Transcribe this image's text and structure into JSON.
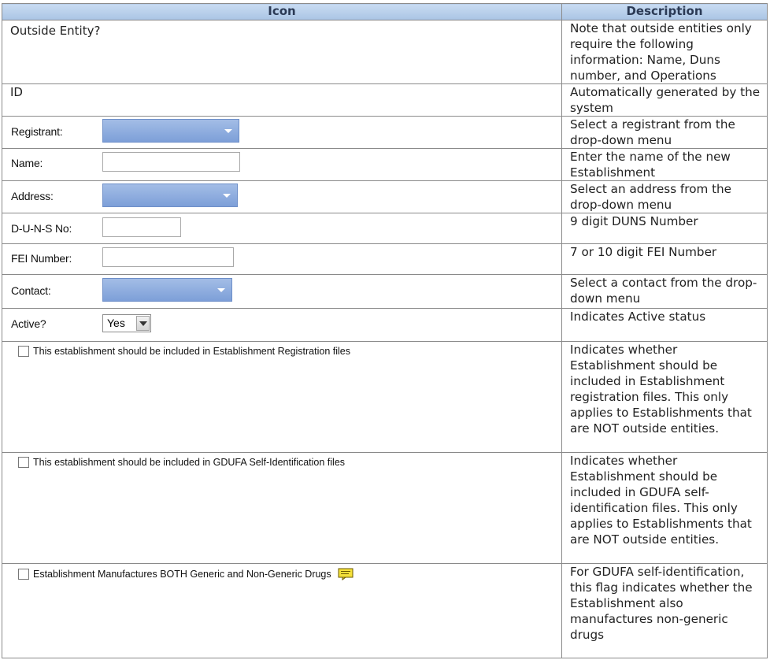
{
  "header": {
    "col_icon": "Icon",
    "col_desc": "Description"
  },
  "rows": {
    "outside": {
      "label": "Outside Entity?",
      "desc": "Note that outside entities only require the following information: Name, Duns number, and Operations"
    },
    "id": {
      "label": "ID",
      "desc": " Automatically generated by the system"
    },
    "registrant": {
      "label": "Registrant:",
      "desc": "Select a registrant from the drop-down menu"
    },
    "name": {
      "label": "Name:",
      "desc": "Enter the name of the new Establishment"
    },
    "address": {
      "label": "Address:",
      "desc": "Select an address from the drop-down menu"
    },
    "duns": {
      "label": "D-U-N-S No:",
      "desc": "9 digit DUNS Number"
    },
    "fei": {
      "label": "FEI Number:",
      "desc": "7 or 10 digit FEI Number"
    },
    "contact": {
      "label": "Contact:",
      "desc": "Select a contact from the drop-down menu"
    },
    "active": {
      "label": "Active?",
      "value": "Yes",
      "desc": "Indicates Active status"
    },
    "est_reg": {
      "label": "This establishment should be included in Establishment Registration files",
      "checked": false,
      "desc": "Indicates whether Establishment should be included in Establishment registration files. This only applies to Establishments that are NOT outside entities."
    },
    "gdufa": {
      "label": "This establishment should be included in GDUFA Self-Identification files",
      "checked": false,
      "desc": "Indicates whether Establishment should be included in GDUFA self-identification files. This only applies to Establishments that are NOT outside entities."
    },
    "both": {
      "label": "Establishment Manufactures BOTH Generic and Non-Generic Drugs",
      "checked": false,
      "icon": "note-icon",
      "desc": "For GDUFA self-identification, this flag indicates whether the Establishment also manufactures non-generic drugs"
    }
  },
  "colors": {
    "header_bg": "#b9d0ec",
    "dropdown_bg": "#8fadde",
    "border": "#8a8a8a"
  }
}
